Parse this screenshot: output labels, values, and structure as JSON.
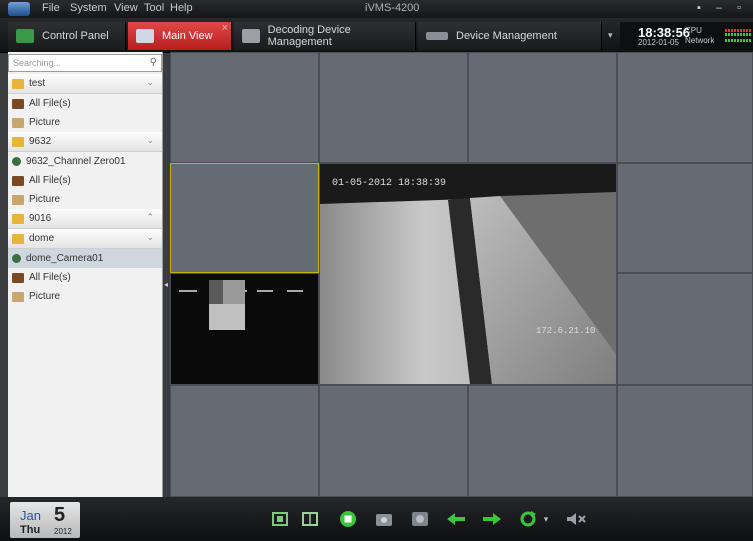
{
  "menu": {
    "items": [
      "File",
      "System",
      "View",
      "Tool",
      "Help"
    ],
    "app_title": "iVMS-4200",
    "window_controls": "▪ – ▫"
  },
  "tabs": [
    {
      "label": "Control Panel",
      "icon": "monitor-icon",
      "active": false
    },
    {
      "label": "Main View",
      "icon": "camera-view-icon",
      "active": true
    },
    {
      "label": "Decoding Device Management",
      "icon": "decoder-icon",
      "active": false
    },
    {
      "label": "Device Management",
      "icon": "device-icon",
      "active": false
    }
  ],
  "clock": {
    "dropdown": "▾",
    "time": "18:38:56",
    "date": "2012-01-05",
    "cpu_label": "CPU",
    "network_label": "Network"
  },
  "sidebar": {
    "search_placeholder": "Searching...",
    "search_icon": "🔍",
    "tree": [
      {
        "type": "group",
        "label": "test",
        "icon": "folder-icon",
        "arrow": "⌄"
      },
      {
        "type": "item",
        "label": "All File(s)",
        "icon": "files-icon"
      },
      {
        "type": "item",
        "label": "Picture",
        "icon": "picture-icon"
      },
      {
        "type": "group",
        "label": "9632",
        "icon": "folder-icon",
        "arrow": "⌄"
      },
      {
        "type": "item",
        "label": "9632_Channel Zero01",
        "icon": "camera-icon"
      },
      {
        "type": "item",
        "label": "All File(s)",
        "icon": "files-icon"
      },
      {
        "type": "item",
        "label": "Picture",
        "icon": "picture-icon"
      },
      {
        "type": "group",
        "label": "9016",
        "icon": "folder-icon",
        "arrow": "⌃"
      },
      {
        "type": "group",
        "label": "dome",
        "icon": "folder-icon",
        "arrow": "⌄"
      },
      {
        "type": "item",
        "label": "dome_Camera01",
        "icon": "camera-icon",
        "selected": true
      },
      {
        "type": "item",
        "label": "All File(s)",
        "icon": "files-icon"
      },
      {
        "type": "item",
        "label": "Picture",
        "icon": "picture-icon"
      }
    ]
  },
  "video": {
    "osd_timestamp": "01-05-2012 18:38:39",
    "osd_ip": "172.6.21.10",
    "splitter_arrow": "◂"
  },
  "bottom": {
    "month": "Jan",
    "day": "5",
    "weekday": "Thu",
    "year": "2012",
    "toolbar_icons": [
      "fullscreen-icon",
      "layout-icon",
      "stop-all-icon",
      "capture-icon",
      "record-icon",
      "previous-icon",
      "next-icon",
      "cycle-icon",
      "dropdown-icon",
      "volume-icon"
    ]
  }
}
